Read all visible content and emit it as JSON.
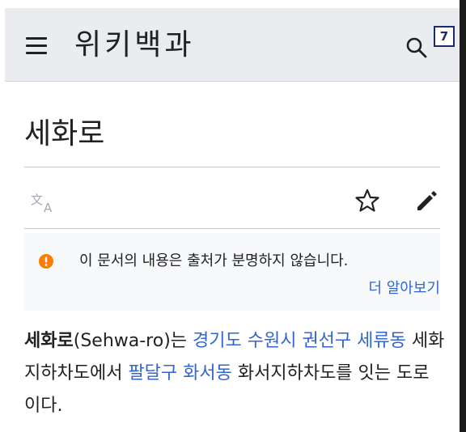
{
  "header": {
    "wordmark": "위키백과",
    "marker_label": "7"
  },
  "article": {
    "title": "세화로"
  },
  "notice": {
    "text": "이 문서의 내용은 출처가 분명하지 않습니다.",
    "link": "더 알아보기"
  },
  "body": {
    "term": "세화로",
    "romanization": "(Sehwa-ro)는 ",
    "link_1": "경기도 수원시 권선구 세류동",
    "text_1": " 세화지하차도에서 ",
    "link_2": "팔달구 화서동",
    "text_2": " 화서지하차도를 잇는 도로이다."
  },
  "icons": {
    "menu": "hamburger-menu-icon",
    "search": "search-icon",
    "language": "language-icon",
    "watch": "star-icon",
    "edit": "pencil-icon",
    "notice": "alert-icon"
  },
  "colors": {
    "link": "#3366cc",
    "alert": "#fc7e00",
    "header_bg": "#eaecf0",
    "notice_bg": "#f8f9fa"
  }
}
